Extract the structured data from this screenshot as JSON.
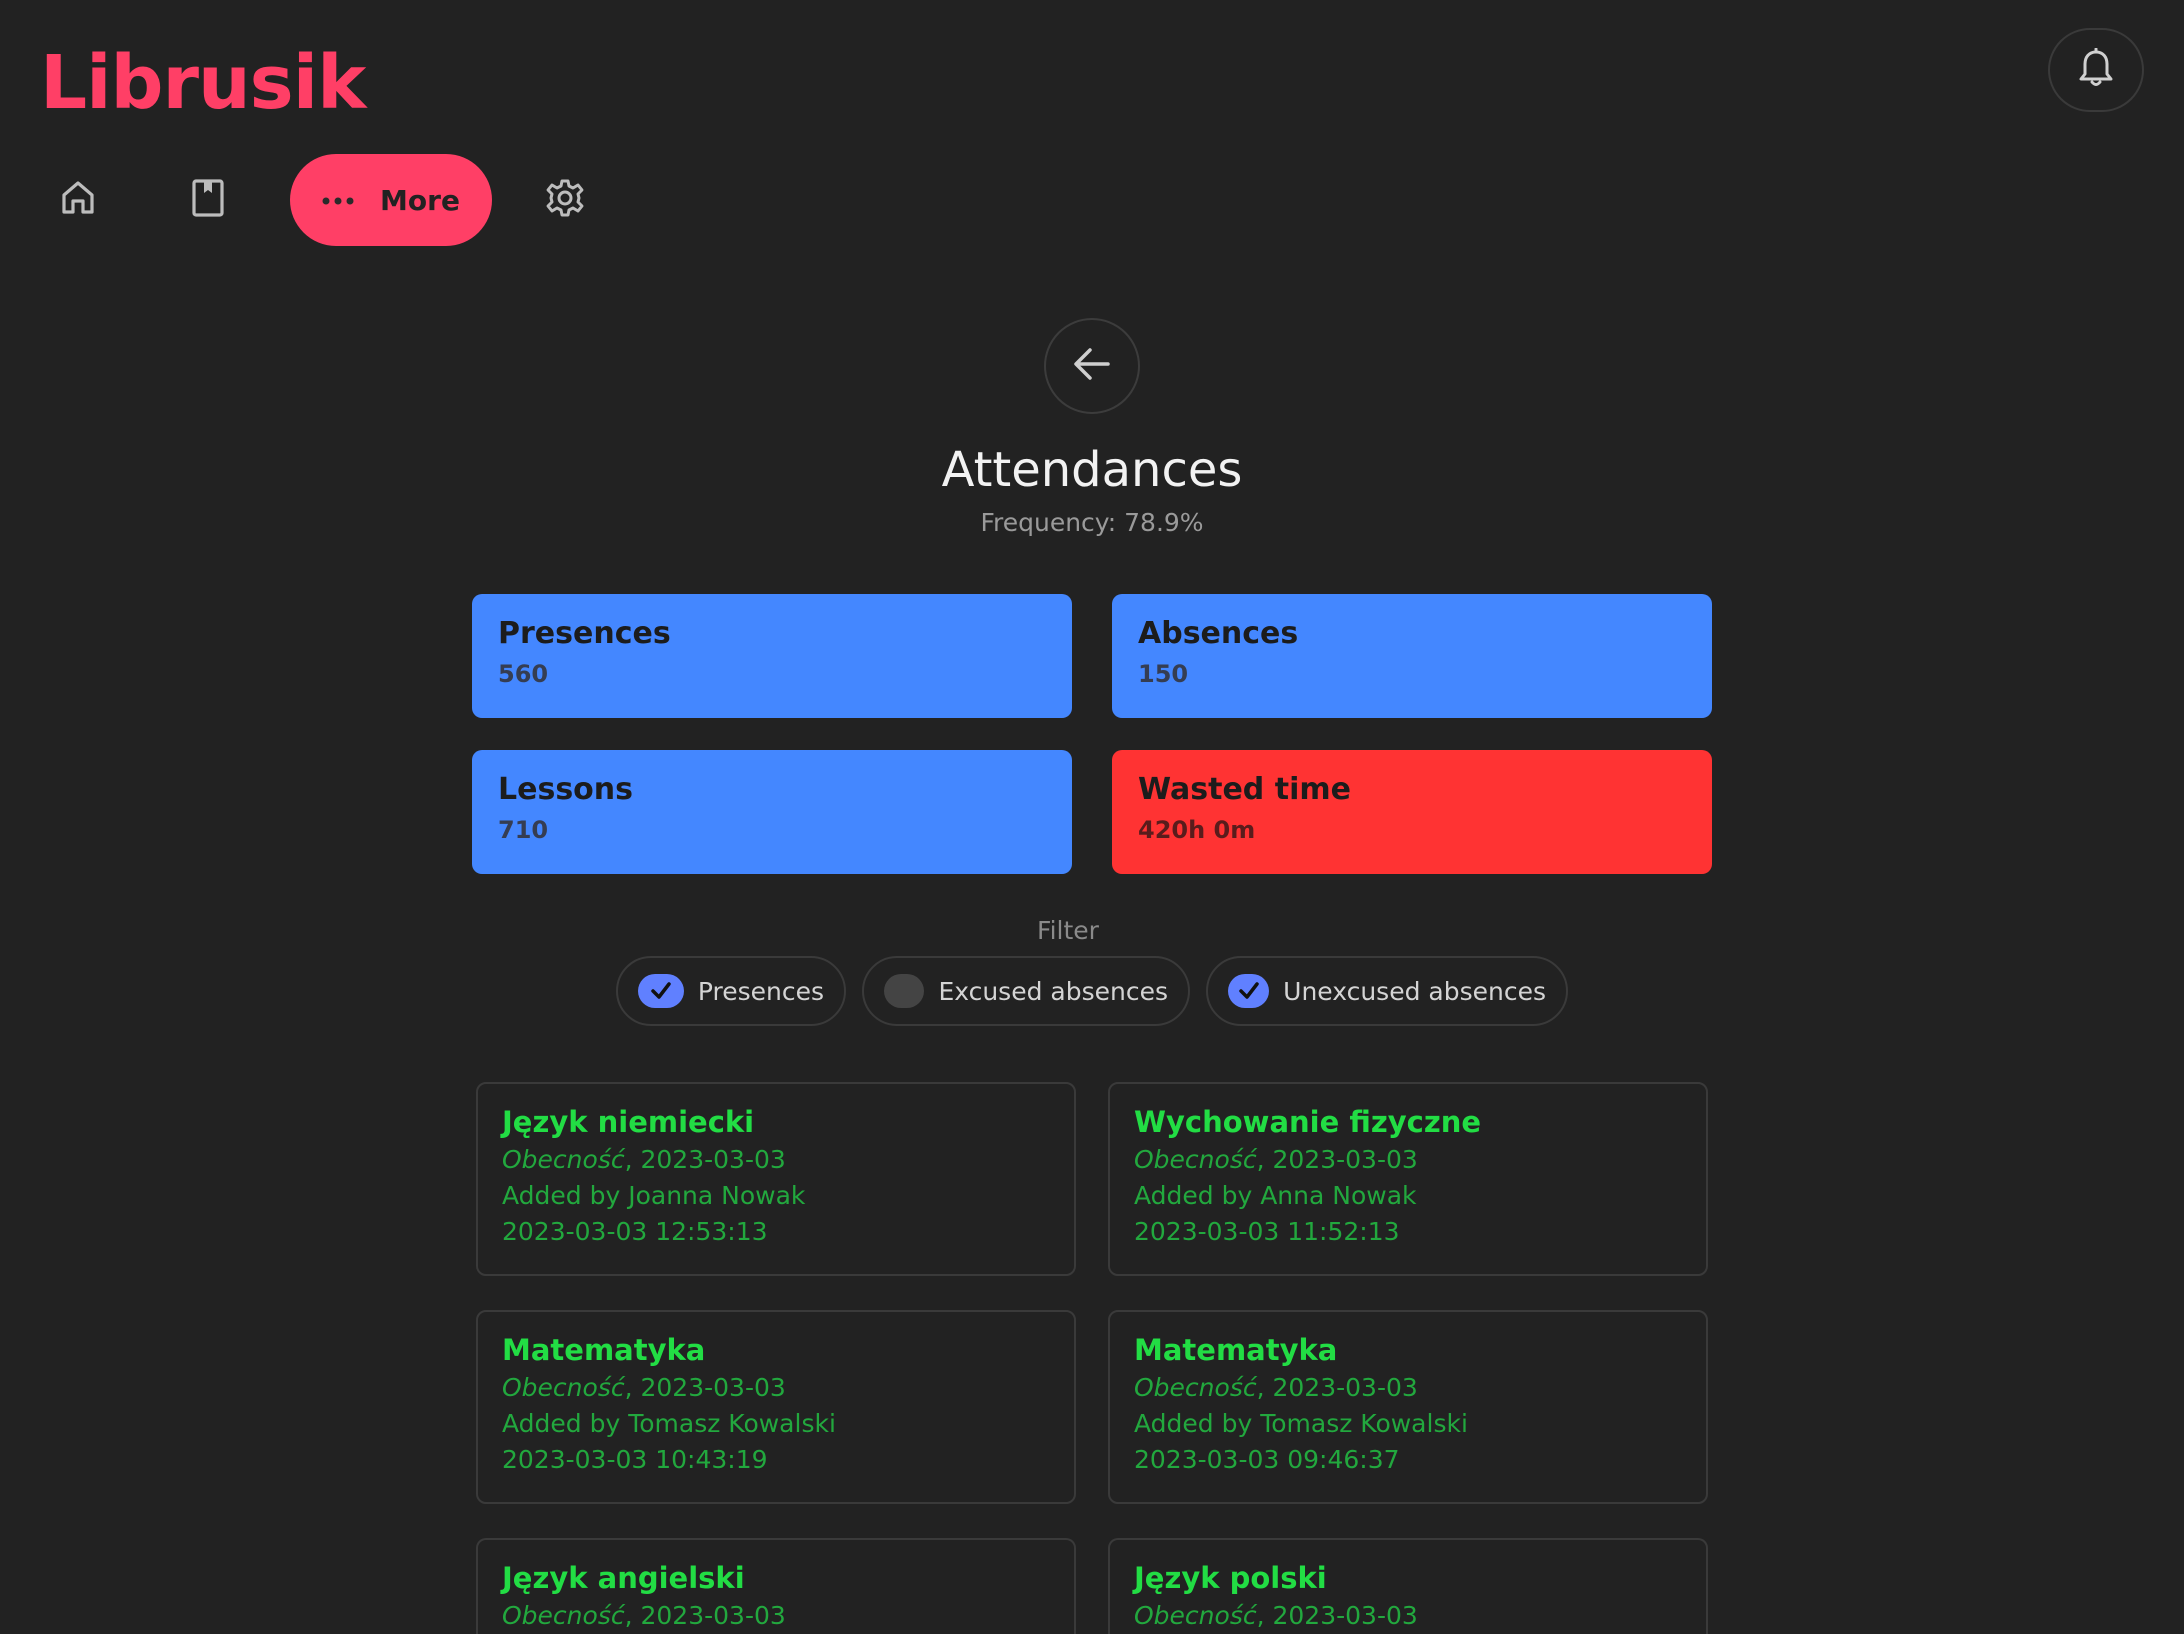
{
  "app": {
    "title": "Librusik"
  },
  "header": {
    "notifications_icon": "bell-icon"
  },
  "nav": {
    "home_icon": "home-icon",
    "grades_icon": "book-icon",
    "more_label": "More",
    "more_icon": "more-dots-icon",
    "settings_icon": "gear-icon",
    "accent_color": "#ff3f66"
  },
  "page": {
    "title": "Attendances",
    "subtitle": "Frequency: 78.9%"
  },
  "stats": [
    {
      "label": "Presences",
      "value": "560",
      "color": "#4487ff"
    },
    {
      "label": "Absences",
      "value": "150",
      "color": "#4487ff"
    },
    {
      "label": "Lessons",
      "value": "710",
      "color": "#4487ff"
    },
    {
      "label": "Wasted time",
      "value": "420h 0m",
      "color": "#ff3333"
    }
  ],
  "filter": {
    "label": "Filter",
    "options": [
      {
        "label": "Presences",
        "checked": true
      },
      {
        "label": "Excused absences",
        "checked": false
      },
      {
        "label": "Unexcused absences",
        "checked": true
      }
    ]
  },
  "attendances": [
    {
      "subject": "Język niemiecki",
      "type": "Obecność",
      "date": ", 2023-03-03",
      "added_by": "Added by Joanna Nowak",
      "timestamp": "2023-03-03 12:53:13"
    },
    {
      "subject": "Wychowanie fizyczne",
      "type": "Obecność",
      "date": ", 2023-03-03",
      "added_by": "Added by Anna Nowak",
      "timestamp": "2023-03-03 11:52:13"
    },
    {
      "subject": "Matematyka",
      "type": "Obecność",
      "date": ", 2023-03-03",
      "added_by": "Added by Tomasz Kowalski",
      "timestamp": "2023-03-03 10:43:19"
    },
    {
      "subject": "Matematyka",
      "type": "Obecność",
      "date": ", 2023-03-03",
      "added_by": "Added by Tomasz Kowalski",
      "timestamp": "2023-03-03 09:46:37"
    },
    {
      "subject": "Język angielski",
      "type": "Obecność",
      "date": ", 2023-03-03",
      "added_by": "",
      "timestamp": ""
    },
    {
      "subject": "Język polski",
      "type": "Obecność",
      "date": ", 2023-03-03",
      "added_by": "",
      "timestamp": ""
    }
  ]
}
